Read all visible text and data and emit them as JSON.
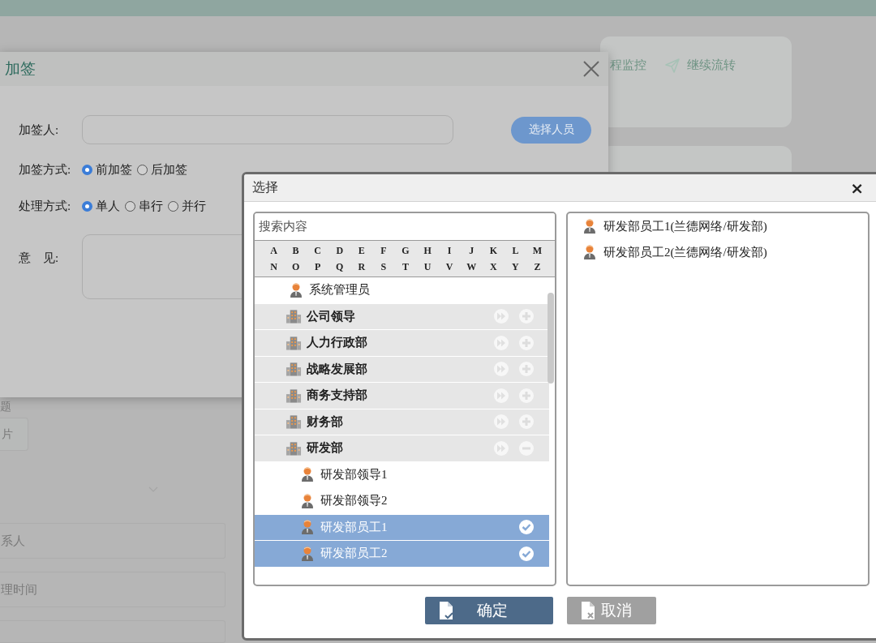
{
  "background_page": {
    "toolbar": [
      {
        "label": "程监控",
        "kind": "plain"
      },
      {
        "label": "继续流转",
        "kind": "send"
      }
    ],
    "tab_fragment": "题",
    "button_fragment": "片",
    "field_fragments": [
      "系人",
      "理时间"
    ]
  },
  "countersign_dialog": {
    "title": "加签",
    "fields": [
      {
        "kind": "input",
        "label": "加签人:",
        "button": "选择人员"
      },
      {
        "kind": "radio",
        "label": "加签方式:",
        "options": [
          {
            "label": "前加签",
            "selected": true
          },
          {
            "label": "后加签",
            "selected": false
          }
        ]
      },
      {
        "kind": "radio",
        "label": "处理方式:",
        "options": [
          {
            "label": "单人",
            "selected": true
          },
          {
            "label": "串行",
            "selected": false
          },
          {
            "label": "并行",
            "selected": false
          }
        ]
      },
      {
        "kind": "textarea",
        "label": "意　见:"
      }
    ]
  },
  "select_dialog": {
    "title": "选择",
    "close": "×",
    "search": {
      "placeholder": "搜索内容"
    },
    "letters": [
      "A",
      "B",
      "C",
      "D",
      "E",
      "F",
      "G",
      "H",
      "I",
      "J",
      "K",
      "L",
      "M",
      "N",
      "O",
      "P",
      "Q",
      "R",
      "S",
      "T",
      "U",
      "V",
      "W",
      "X",
      "Y",
      "Z"
    ],
    "tree": [
      {
        "kind": "person",
        "name": "系统管理员",
        "selected": false
      },
      {
        "kind": "department",
        "name": "公司领导",
        "expanded": false
      },
      {
        "kind": "department",
        "name": "人力行政部",
        "expanded": false
      },
      {
        "kind": "department",
        "name": "战略发展部",
        "expanded": false
      },
      {
        "kind": "department",
        "name": "商务支持部",
        "expanded": false
      },
      {
        "kind": "department",
        "name": "财务部",
        "expanded": false
      },
      {
        "kind": "department",
        "name": "研发部",
        "expanded": true,
        "children": [
          {
            "kind": "person",
            "name": "研发部领导1",
            "selected": false
          },
          {
            "kind": "person",
            "name": "研发部领导2",
            "selected": false
          },
          {
            "kind": "person",
            "name": "研发部员工1",
            "selected": true
          },
          {
            "kind": "person",
            "name": "研发部员工2",
            "selected": true
          }
        ]
      }
    ],
    "selected_list": [
      "研发部员工1(兰德网络/研发部)",
      "研发部员工2(兰德网络/研发部)"
    ],
    "buttons": [
      {
        "label": "确定",
        "kind": "confirm"
      },
      {
        "label": "取消",
        "kind": "cancel"
      }
    ]
  }
}
